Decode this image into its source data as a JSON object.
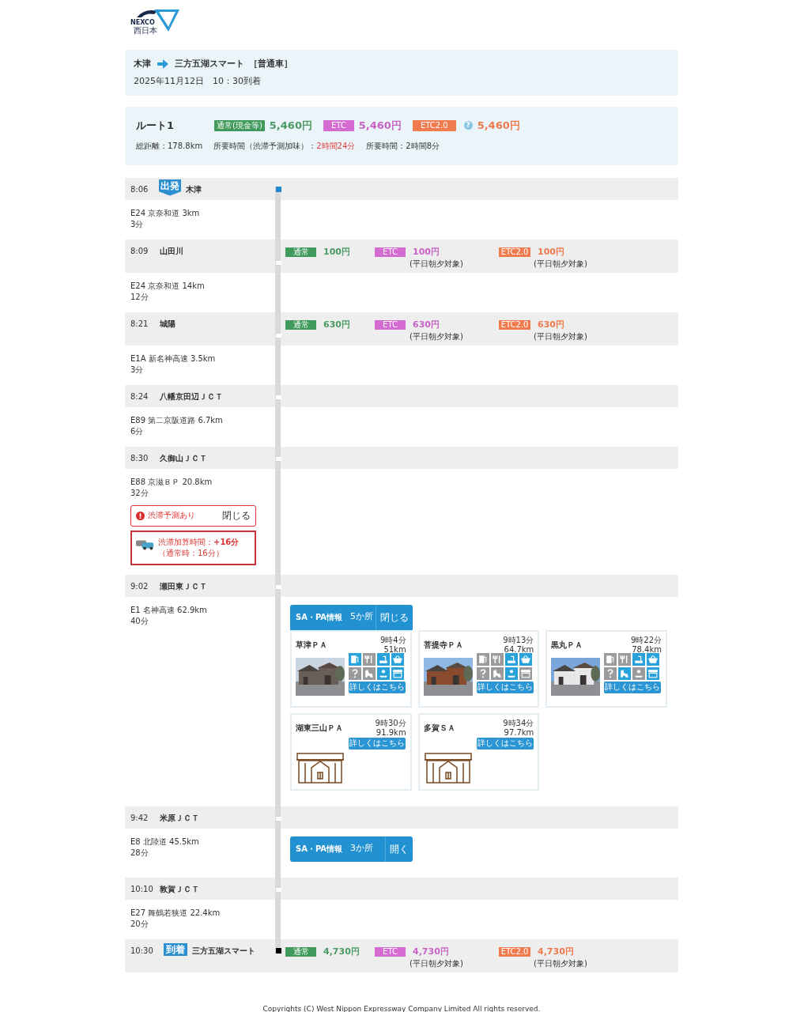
{
  "logo": {
    "brand": "NEXCO",
    "region": "西日本"
  },
  "search": {
    "from": "木津",
    "to": "三方五湖スマート",
    "vehicle": "［普通車］",
    "arrival": "2025年11月12日　10：30到着"
  },
  "route": {
    "title": "ルート1",
    "fares": [
      {
        "kind": "cash",
        "label": "通常(現金等)",
        "amount": "5,460円"
      },
      {
        "kind": "etc",
        "label": "ETC",
        "amount": "5,460円"
      },
      {
        "kind": "etc2",
        "label": "ETC2.0",
        "amount": "5,460円",
        "help": "?"
      }
    ],
    "summary": [
      {
        "label": "総距離：",
        "value": "178.8km",
        "alert": false
      },
      {
        "label": "所要時間（渋滞予測加味）：",
        "value": "2時間24分",
        "alert": true
      },
      {
        "label": "所要時間：",
        "value": "2時間8分",
        "alert": false
      }
    ]
  },
  "timeline": [
    {
      "kind": "stop",
      "time": "8:06",
      "name": "木津",
      "badge": {
        "kind": "depart",
        "label": "出発"
      }
    },
    {
      "kind": "segment",
      "road": "E24 京奈和道 3km",
      "duration": "3分"
    },
    {
      "kind": "stop",
      "time": "8:09",
      "name": "山田川",
      "tolls": [
        {
          "kind": "cash",
          "label": "通常",
          "amount": "100円"
        },
        {
          "kind": "etc",
          "label": "ETC",
          "amount": "100円",
          "note": "(平日朝夕対象)"
        },
        {
          "kind": "etc2",
          "label": "ETC2.0",
          "amount": "100円",
          "note": "(平日朝夕対象)"
        }
      ]
    },
    {
      "kind": "segment",
      "road": "E24 京奈和道 14km",
      "duration": "12分"
    },
    {
      "kind": "stop",
      "time": "8:21",
      "name": "城陽",
      "tolls": [
        {
          "kind": "cash",
          "label": "通常",
          "amount": "630円"
        },
        {
          "kind": "etc",
          "label": "ETC",
          "amount": "630円",
          "note": "(平日朝夕対象)"
        },
        {
          "kind": "etc2",
          "label": "ETC2.0",
          "amount": "630円",
          "note": "(平日朝夕対象)"
        }
      ]
    },
    {
      "kind": "segment",
      "road": "E1A 新名神高速 3.5km",
      "duration": "3分"
    },
    {
      "kind": "stop",
      "time": "8:24",
      "name": "八幡京田辺ＪＣＴ"
    },
    {
      "kind": "segment",
      "road": "E89 第二京阪道路 6.7km",
      "duration": "6分"
    },
    {
      "kind": "stop",
      "time": "8:30",
      "name": "久御山ＪＣＴ"
    },
    {
      "kind": "segment",
      "road": "E88 京滋ＢＰ 20.8km",
      "duration": "32分",
      "congestion": {
        "title": "渋滞予測あり",
        "close": "閉じる",
        "delay": "渋滞加算時間：**+16分**",
        "normal": "（通常時：16分）"
      }
    },
    {
      "kind": "stop",
      "time": "9:02",
      "name": "瀬田東ＪＣＴ"
    },
    {
      "kind": "segment",
      "road": "E1 名神高速 62.9km",
      "duration": "40分",
      "sapa": {
        "title": "SA・PA情報",
        "count": "5か所",
        "toggle": "閉じる",
        "expanded": true,
        "cards": [
          {
            "name": "草津ＰＡ",
            "time": "9時4分",
            "distance": "51km",
            "facilities": [
              {
                "on": true
              },
              {
                "on": false
              },
              {
                "on": true
              },
              {
                "on": true
              },
              {
                "on": false
              },
              {
                "on": false
              },
              {
                "on": true
              },
              {
                "on": true
              }
            ],
            "link": "詳しくはこちら"
          },
          {
            "name": "菩提寺ＰＡ",
            "time": "9時13分",
            "distance": "64.7km",
            "facilities": [
              {
                "on": false
              },
              {
                "on": false
              },
              {
                "on": true
              },
              {
                "on": true
              },
              {
                "on": false
              },
              {
                "on": false
              },
              {
                "on": true
              },
              {
                "on": false
              }
            ],
            "link": "詳しくはこちら"
          },
          {
            "name": "黒丸ＰＡ",
            "time": "9時22分",
            "distance": "78.4km",
            "facilities": [
              {
                "on": false
              },
              {
                "on": false
              },
              {
                "on": true
              },
              {
                "on": true
              },
              {
                "on": false
              },
              {
                "on": true
              },
              {
                "on": false
              },
              {
                "on": true
              }
            ],
            "link": "詳しくはこちら"
          },
          {
            "name": "湖東三山ＰＡ",
            "time": "9時30分",
            "distance": "91.9km",
            "kind": "placeholder",
            "link": "詳しくはこちら"
          },
          {
            "name": "多賀ＳＡ",
            "time": "9時34分",
            "distance": "97.7km",
            "kind": "placeholder",
            "link": "詳しくはこちら"
          }
        ]
      }
    },
    {
      "kind": "stop",
      "time": "9:42",
      "name": "米原ＪＣＴ"
    },
    {
      "kind": "segment",
      "road": "E8 北陸道 45.5km",
      "duration": "28分",
      "sapa": {
        "title": "SA・PA情報",
        "count": "3か所",
        "toggle": "開く",
        "expanded": false
      }
    },
    {
      "kind": "stop",
      "time": "10:10",
      "name": "敦賀ＪＣＴ"
    },
    {
      "kind": "segment",
      "road": "E27 舞鶴若狭道 22.4km",
      "duration": "20分"
    },
    {
      "kind": "stop",
      "time": "10:30",
      "name": "三方五湖スマート",
      "badge": {
        "kind": "arrive",
        "label": "到着"
      },
      "tolls": [
        {
          "kind": "cash",
          "label": "通常",
          "amount": "4,730円"
        },
        {
          "kind": "etc",
          "label": "ETC",
          "amount": "4,730円",
          "note": "(平日朝夕対象)"
        },
        {
          "kind": "etc2",
          "label": "ETC2.0",
          "amount": "4,730円",
          "note": "(平日朝夕対象)"
        }
      ]
    }
  ],
  "footer": "Copyrights (C) West Nippon Expressway Company Limited All rights reserved."
}
